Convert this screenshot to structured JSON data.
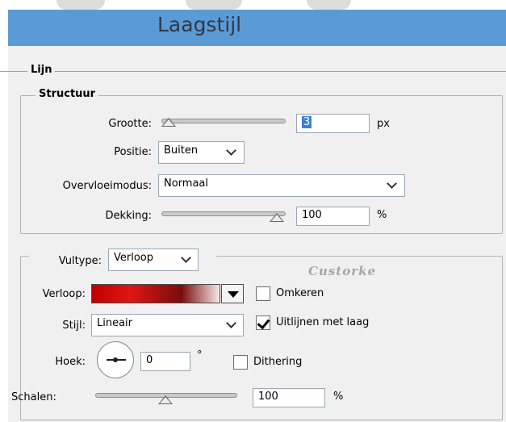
{
  "window": {
    "title": "Laagstijl"
  },
  "section": {
    "lijn": "Lijn",
    "structuur": "Structuur"
  },
  "structure": {
    "grootte_label": "Grootte:",
    "grootte_value": "3",
    "grootte_unit": "px",
    "positie_label": "Positie:",
    "positie_value": "Buiten",
    "overvloei_label": "Overvloeimodus:",
    "overvloei_value": "Normaal",
    "dekking_label": "Dekking:",
    "dekking_value": "100",
    "dekking_unit": "%"
  },
  "fill": {
    "vultype_label": "Vultype:",
    "vultype_value": "Verloop",
    "watermark": "Custorke",
    "verloop_label": "Verloop:",
    "omkeren_label": "Omkeren",
    "omkeren_checked": false,
    "stijl_label": "Stijl:",
    "stijl_value": "Lineair",
    "uitlijnen_label": "Uitlijnen met laag",
    "uitlijnen_checked": true,
    "hoek_label": "Hoek:",
    "hoek_value": "0",
    "hoek_unit": "°",
    "dithering_label": "Dithering",
    "dithering_checked": false,
    "schalen_label": "Schalen:",
    "schalen_value": "100",
    "schalen_unit": "%"
  },
  "sliders": {
    "grootte_fraction": 0.0,
    "dekking_fraction": 1.0,
    "schalen_fraction": 0.5
  },
  "colors": {
    "titlebar": "#5b9bd5",
    "gradient_start": "#c00000",
    "gradient_end": "#f6e7e7",
    "selection": "#3d7fd9"
  }
}
